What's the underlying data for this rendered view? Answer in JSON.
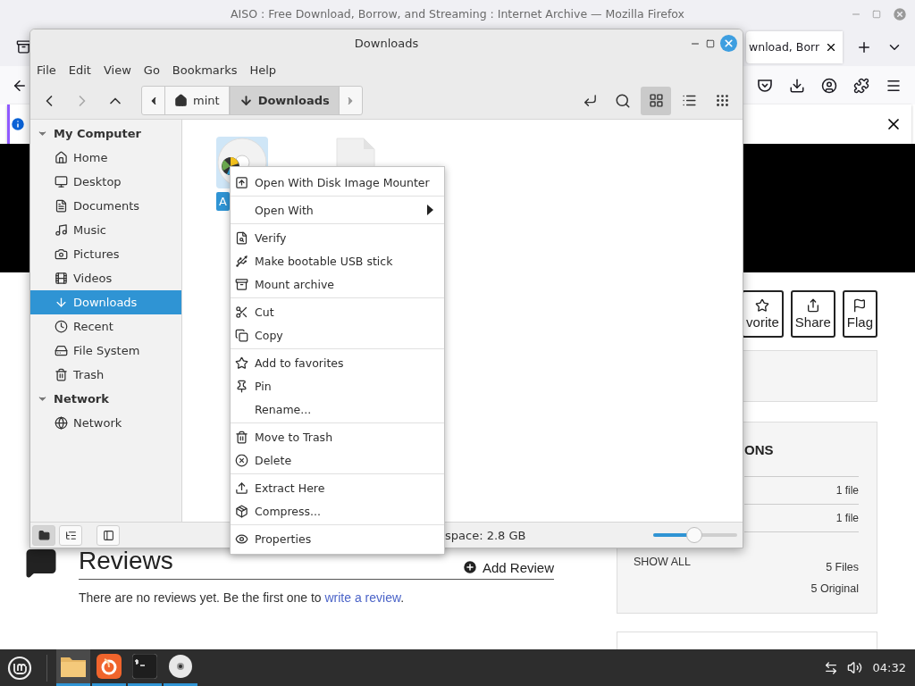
{
  "browser": {
    "title": "AISO : Free Download, Borrow, and Streaming : Internet Archive — Mozilla Firefox",
    "tab": {
      "label": "wnload, Borr"
    },
    "page": {
      "actions": [
        {
          "label": "vorite"
        },
        {
          "label": "Share"
        },
        {
          "label": "Flag"
        }
      ],
      "files_panel": {
        "heading": "ONS",
        "rows": [
          "1 file",
          "1 file"
        ],
        "show_all": "SHOW ALL",
        "totals": [
          "5 Files",
          "5 Original"
        ]
      },
      "reviews": {
        "title": "Reviews",
        "add_button": "Add Review",
        "text": "There are no reviews yet. Be the first one to ",
        "link": "write a review",
        "text_end": "."
      }
    }
  },
  "file_manager": {
    "title": "Downloads",
    "menu": [
      "File",
      "Edit",
      "View",
      "Go",
      "Bookmarks",
      "Help"
    ],
    "nav": [
      {
        "disabled": false
      },
      {
        "disabled": true
      },
      {
        "disabled": false
      }
    ],
    "path": [
      {
        "label": "mint",
        "selected": false
      },
      {
        "label": "Downloads",
        "selected": true
      }
    ],
    "views": [
      {
        "selected": true
      },
      {
        "selected": false
      },
      {
        "selected": false
      }
    ],
    "sidebar": [
      {
        "label": "My Computer",
        "expanded": true,
        "children": [
          {
            "label": "Home",
            "selected": false
          },
          {
            "label": "Desktop",
            "selected": false
          },
          {
            "label": "Documents",
            "selected": false
          },
          {
            "label": "Music",
            "selected": false
          },
          {
            "label": "Pictures",
            "selected": false
          },
          {
            "label": "Videos",
            "selected": false
          },
          {
            "label": "Downloads",
            "selected": true
          },
          {
            "label": "Recent",
            "selected": false
          },
          {
            "label": "File System",
            "selected": false
          },
          {
            "label": "Trash",
            "selected": false
          }
        ]
      },
      {
        "label": "Network",
        "expanded": true,
        "children": [
          {
            "label": "Network",
            "selected": false
          }
        ]
      }
    ],
    "files": [
      {
        "kind": "disc",
        "label": "A",
        "selected": true
      },
      {
        "kind": "document",
        "selected": false
      }
    ],
    "statusbar": {
      "panes": [
        {
          "selected": true
        },
        {
          "selected": false
        }
      ],
      "free_space": "space: 2.8 GB",
      "zoom": {
        "level": 0.49
      }
    }
  },
  "context_menu": {
    "groups": [
      [
        {
          "label": "Open With Disk Image Mounter",
          "submenu": false
        }
      ],
      [
        {
          "label": "Open With",
          "submenu": true
        }
      ],
      [
        {
          "label": "Verify",
          "submenu": false
        },
        {
          "label": "Make bootable USB stick",
          "submenu": false
        },
        {
          "label": "Mount archive",
          "submenu": false
        }
      ],
      [
        {
          "label": "Cut",
          "submenu": false
        },
        {
          "label": "Copy",
          "submenu": false
        }
      ],
      [
        {
          "label": "Add to favorites",
          "submenu": false
        },
        {
          "label": "Pin",
          "submenu": false
        },
        {
          "label": "Rename...",
          "submenu": false
        }
      ],
      [
        {
          "label": "Move to Trash",
          "submenu": false
        },
        {
          "label": "Delete",
          "submenu": false
        }
      ],
      [
        {
          "label": "Extract Here",
          "submenu": false
        },
        {
          "label": "Compress...",
          "submenu": false
        }
      ],
      [
        {
          "label": "Properties",
          "submenu": false
        }
      ]
    ]
  },
  "taskbar": {
    "apps": [
      {
        "selected": true,
        "running": true
      },
      {
        "selected": false,
        "running": true
      },
      {
        "selected": false,
        "running": true
      },
      {
        "selected": false,
        "running": true
      }
    ],
    "clock": "04:32"
  }
}
